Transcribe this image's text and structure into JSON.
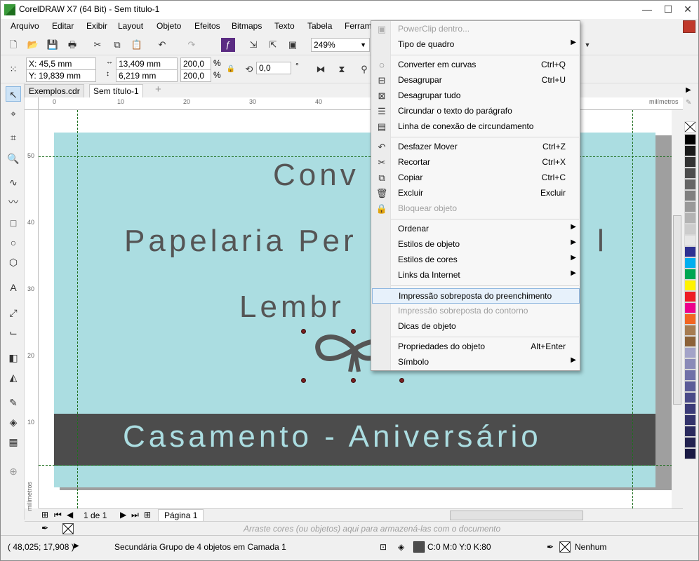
{
  "window": {
    "title": "CorelDRAW X7 (64 Bit) - Sem título-1",
    "minimize": "—",
    "maximize": "☐",
    "close": "✕"
  },
  "menubar": [
    "Arquivo",
    "Editar",
    "Exibir",
    "Layout",
    "Objeto",
    "Efeitos",
    "Bitmaps",
    "Texto",
    "Tabela",
    "Ferram"
  ],
  "toolbar": {
    "zoom": "249%"
  },
  "property_bar": {
    "x": "X: 45,5 mm",
    "y": "Y: 19,839 mm",
    "width": "13,409 mm",
    "height": "6,219 mm",
    "scale_x": "200,0",
    "scale_y": "200,0",
    "percent": "%",
    "rotation": "0,0",
    "degree": "°"
  },
  "doc_tabs": [
    "Exemplos.cdr",
    "Sem título-1"
  ],
  "ruler": {
    "unit": "milímetros",
    "h_ticks": [
      "0",
      "10",
      "20",
      "30",
      "40"
    ],
    "v_ticks": [
      "50",
      "40",
      "30",
      "20",
      "10"
    ],
    "v_unit": "milímetros"
  },
  "page_text": {
    "line1": "Conv",
    "line2": "Papelaria Per",
    "line3": "Lembr",
    "band": "Casamento - Aniversário",
    "right_fragment": "l"
  },
  "pager": {
    "count": "1 de 1",
    "page_tab": "Página 1"
  },
  "color_doc_bar": {
    "hint": "Arraste cores (ou objetos) aqui para armazená-las com o documento"
  },
  "status": {
    "coords": "( 48,025; 17,908 )",
    "info": "Secundária Grupo de 4 objetos em Camada 1",
    "fill": "C:0 M:0 Y:0 K:80",
    "outline": "Nenhum"
  },
  "context_menu": {
    "items": [
      {
        "label": "PowerClip dentro...",
        "shortcut": "",
        "submenu": false,
        "disabled": true,
        "highlighted": false,
        "icon": "powerclip-icon"
      },
      {
        "label": "Tipo de quadro",
        "shortcut": "",
        "submenu": true,
        "disabled": false,
        "highlighted": false,
        "icon": ""
      },
      {
        "sep": true
      },
      {
        "label": "Converter em curvas",
        "shortcut": "Ctrl+Q",
        "submenu": false,
        "disabled": false,
        "highlighted": false,
        "icon": "convert-curves-icon"
      },
      {
        "label": "Desagrupar",
        "shortcut": "Ctrl+U",
        "submenu": false,
        "disabled": false,
        "highlighted": false,
        "icon": "ungroup-icon"
      },
      {
        "label": "Desagrupar tudo",
        "shortcut": "",
        "submenu": false,
        "disabled": false,
        "highlighted": false,
        "icon": "ungroup-all-icon"
      },
      {
        "label": "Circundar o texto do parágrafo",
        "shortcut": "",
        "submenu": false,
        "disabled": false,
        "highlighted": false,
        "icon": "wrap-text-icon"
      },
      {
        "label": "Linha de conexão de circundamento",
        "shortcut": "",
        "submenu": false,
        "disabled": false,
        "highlighted": false,
        "icon": "wrap-line-icon"
      },
      {
        "sep": true
      },
      {
        "label": "Desfazer Mover",
        "shortcut": "Ctrl+Z",
        "submenu": false,
        "disabled": false,
        "highlighted": false,
        "icon": "undo-icon"
      },
      {
        "label": "Recortar",
        "shortcut": "Ctrl+X",
        "submenu": false,
        "disabled": false,
        "highlighted": false,
        "icon": "scissors-icon"
      },
      {
        "label": "Copiar",
        "shortcut": "Ctrl+C",
        "submenu": false,
        "disabled": false,
        "highlighted": false,
        "icon": "copy-icon"
      },
      {
        "label": "Excluir",
        "shortcut": "Excluir",
        "submenu": false,
        "disabled": false,
        "highlighted": false,
        "icon": "trash-icon"
      },
      {
        "label": "Bloquear objeto",
        "shortcut": "",
        "submenu": false,
        "disabled": true,
        "highlighted": false,
        "icon": "lock-icon"
      },
      {
        "sep": true
      },
      {
        "label": "Ordenar",
        "shortcut": "",
        "submenu": true,
        "disabled": false,
        "highlighted": false,
        "icon": ""
      },
      {
        "label": "Estilos de objeto",
        "shortcut": "",
        "submenu": true,
        "disabled": false,
        "highlighted": false,
        "icon": ""
      },
      {
        "label": "Estilos de cores",
        "shortcut": "",
        "submenu": true,
        "disabled": false,
        "highlighted": false,
        "icon": ""
      },
      {
        "label": "Links da Internet",
        "shortcut": "",
        "submenu": true,
        "disabled": false,
        "highlighted": false,
        "icon": ""
      },
      {
        "sep": true
      },
      {
        "label": "Impressão sobreposta do preenchimento",
        "shortcut": "",
        "submenu": false,
        "disabled": false,
        "highlighted": true,
        "icon": ""
      },
      {
        "label": "Impressão sobreposta do contorno",
        "shortcut": "",
        "submenu": false,
        "disabled": true,
        "highlighted": false,
        "icon": ""
      },
      {
        "label": "Dicas de objeto",
        "shortcut": "",
        "submenu": false,
        "disabled": false,
        "highlighted": false,
        "icon": ""
      },
      {
        "sep": true
      },
      {
        "label": "Propriedades do objeto",
        "shortcut": "Alt+Enter",
        "submenu": false,
        "disabled": false,
        "highlighted": false,
        "icon": ""
      },
      {
        "label": "Símbolo",
        "shortcut": "",
        "submenu": true,
        "disabled": false,
        "highlighted": false,
        "icon": ""
      }
    ]
  },
  "palette": {
    "colors": [
      "#ffffff",
      "#000000",
      "#1a1a1a",
      "#333333",
      "#4d4d4d",
      "#666666",
      "#808080",
      "#999999",
      "#b3b3b3",
      "#cccccc",
      "#e6e6e6",
      "#2e3192",
      "#00aeef",
      "#00a651",
      "#fff200",
      "#ed1c24",
      "#ec008c",
      "#f26522",
      "#a67c52",
      "#8c6239",
      "#a3a3c8",
      "#8a8ab8",
      "#7070a8",
      "#5c5c98",
      "#4a4a88",
      "#3b3b78",
      "#33336b",
      "#2a2a5e",
      "#222250",
      "#1a1a44"
    ]
  }
}
